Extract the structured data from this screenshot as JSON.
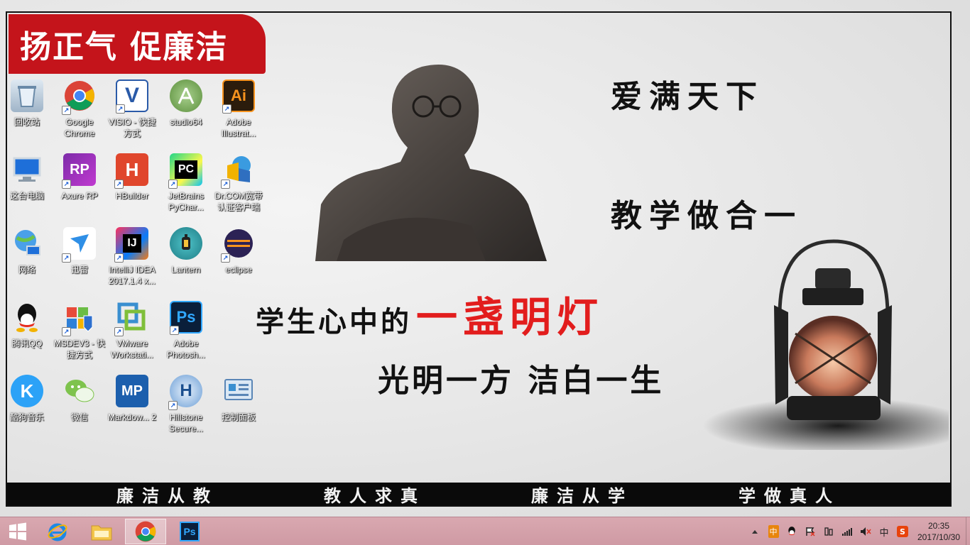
{
  "wallpaper": {
    "banner": "扬正气 促廉洁",
    "slogan_1": "爱满天下",
    "slogan_2": "教学做合一",
    "main_black": "学生心中的",
    "main_red": "一盏明灯",
    "sub_line": "光明一方 洁白一生",
    "bottom_phrases": [
      "廉洁从教",
      "教人求真",
      "廉洁从学",
      "学做真人"
    ],
    "accent_red": "#c4141b"
  },
  "desktop_icons": [
    {
      "label": "回收站",
      "icon": "recycle-bin-icon"
    },
    {
      "label": "Google Chrome",
      "icon": "chrome-icon"
    },
    {
      "label": "VISIO - 快捷方式",
      "icon": "visio-icon"
    },
    {
      "label": "studio64",
      "icon": "android-studio-icon"
    },
    {
      "label": "Adobe Illustrat...",
      "icon": "illustrator-icon"
    },
    {
      "label": "这台电脑",
      "icon": "computer-icon"
    },
    {
      "label": "Axure RP",
      "icon": "axure-icon"
    },
    {
      "label": "HBuilder",
      "icon": "hbuilder-icon"
    },
    {
      "label": "JetBrains PyChar...",
      "icon": "pycharm-icon"
    },
    {
      "label": "Dr.COM宽带认证客户端",
      "icon": "drcom-icon"
    },
    {
      "label": "网络",
      "icon": "network-icon"
    },
    {
      "label": "迅雷",
      "icon": "xunlei-icon"
    },
    {
      "label": "IntelliJ IDEA 2017.1.4 x...",
      "icon": "intellij-icon"
    },
    {
      "label": "Lantern",
      "icon": "lantern-icon"
    },
    {
      "label": "eclipse",
      "icon": "eclipse-icon"
    },
    {
      "label": "腾讯QQ",
      "icon": "qq-icon"
    },
    {
      "label": "MSDEV3 - 快捷方式",
      "icon": "msdev-icon"
    },
    {
      "label": "VMware Workstati...",
      "icon": "vmware-icon"
    },
    {
      "label": "Adobe Photosh...",
      "icon": "photoshop-icon"
    },
    {
      "label": "酷狗音乐",
      "icon": "kugou-icon"
    },
    {
      "label": "微信",
      "icon": "wechat-icon"
    },
    {
      "label": "Markdow... 2",
      "icon": "markdownpad-icon"
    },
    {
      "label": "Hillstone Secure...",
      "icon": "hillstone-icon"
    },
    {
      "label": "控制面板",
      "icon": "control-panel-icon"
    }
  ],
  "taskbar": {
    "apps": [
      {
        "name": "ie",
        "icon": "ie-icon",
        "active": false
      },
      {
        "name": "explorer",
        "icon": "folder-icon",
        "active": false
      },
      {
        "name": "chrome",
        "icon": "chrome-icon",
        "active": true
      },
      {
        "name": "photoshop",
        "icon": "photoshop-icon",
        "active": false
      }
    ],
    "tray": {
      "ime_badge": "中",
      "ime_lang": "中",
      "time": "20:35",
      "date": "2017/10/30"
    }
  }
}
